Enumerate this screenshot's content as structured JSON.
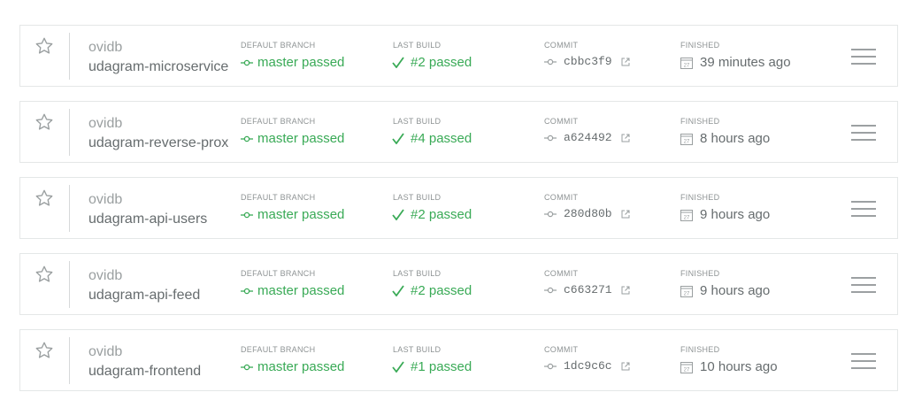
{
  "labels": {
    "default_branch": "DEFAULT BRANCH",
    "last_build": "LAST BUILD",
    "commit": "COMMIT",
    "finished": "FINISHED"
  },
  "colors": {
    "passed": "#39aa56",
    "text_muted": "#9a9fa0",
    "text": "#666c6e",
    "border": "#e4e7e7"
  },
  "repos": [
    {
      "owner": "ovidb",
      "name": "udagram-microservices",
      "branch_status": "master passed",
      "last_build": "#2 passed",
      "commit": "cbbc3f9",
      "finished": "39 minutes ago"
    },
    {
      "owner": "ovidb",
      "name": "udagram-reverse-proxy",
      "branch_status": "master passed",
      "last_build": "#4 passed",
      "commit": "a624492",
      "finished": "8 hours ago"
    },
    {
      "owner": "ovidb",
      "name": "udagram-api-users",
      "branch_status": "master passed",
      "last_build": "#2 passed",
      "commit": "280d80b",
      "finished": "9 hours ago"
    },
    {
      "owner": "ovidb",
      "name": "udagram-api-feed",
      "branch_status": "master passed",
      "last_build": "#2 passed",
      "commit": "c663271",
      "finished": "9 hours ago"
    },
    {
      "owner": "ovidb",
      "name": "udagram-frontend",
      "branch_status": "master passed",
      "last_build": "#1 passed",
      "commit": "1dc9c6c",
      "finished": "10 hours ago"
    }
  ]
}
